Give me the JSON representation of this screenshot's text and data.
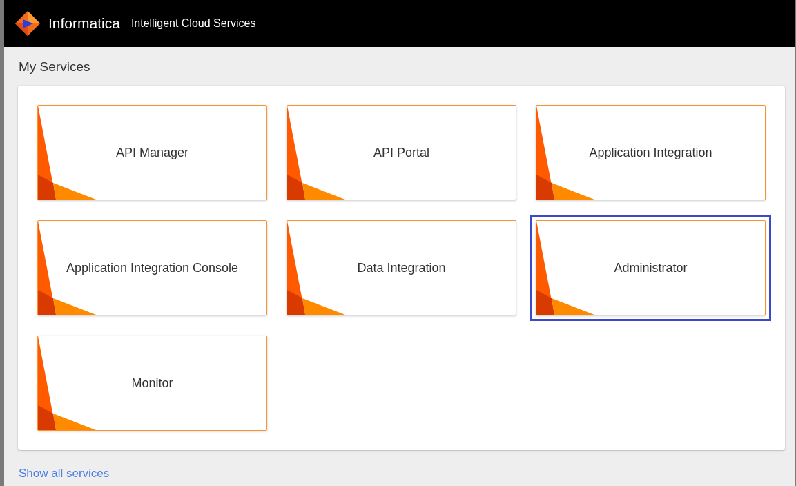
{
  "header": {
    "brand": "Informatica",
    "product": "Intelligent Cloud Services"
  },
  "section_title": "My Services",
  "tiles": [
    {
      "label": "API Manager",
      "selected": false
    },
    {
      "label": "API Portal",
      "selected": false
    },
    {
      "label": "Application Integration",
      "selected": false
    },
    {
      "label": "Application Integration Console",
      "selected": false
    },
    {
      "label": "Data Integration",
      "selected": false
    },
    {
      "label": "Administrator",
      "selected": true
    },
    {
      "label": "Monitor",
      "selected": false
    }
  ],
  "footer_link": "Show all services"
}
